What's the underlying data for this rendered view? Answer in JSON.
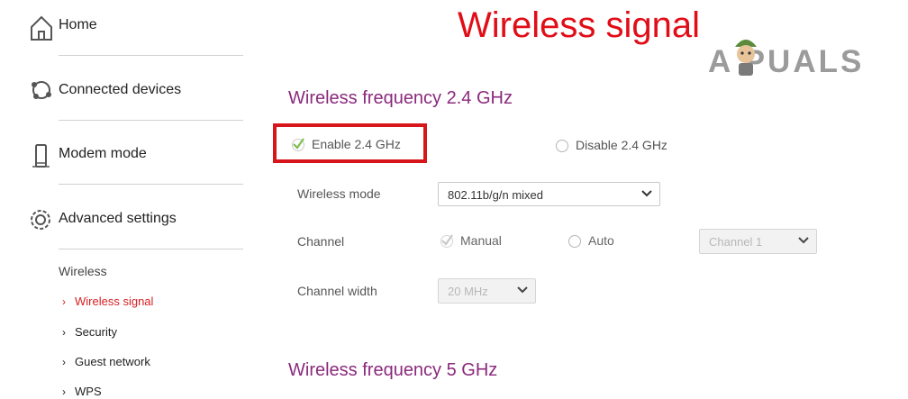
{
  "page": {
    "title": "Wireless signal"
  },
  "watermark": {
    "text": "A  PUALS"
  },
  "sidebar": {
    "items": [
      {
        "label": "Home",
        "icon": "home-icon"
      },
      {
        "label": "Connected devices",
        "icon": "devices-icon"
      },
      {
        "label": "Modem mode",
        "icon": "phone-icon"
      },
      {
        "label": "Advanced settings",
        "icon": "gear-icon"
      }
    ],
    "sub_heading": "Wireless",
    "sub_items": [
      {
        "label": "Wireless signal",
        "active": true
      },
      {
        "label": "Security"
      },
      {
        "label": "Guest network"
      },
      {
        "label": "WPS"
      }
    ]
  },
  "sections": {
    "band24": {
      "title": "Wireless frequency 2.4 GHz",
      "enable_label": "Enable 2.4 GHz",
      "disable_label": "Disable 2.4 GHz",
      "wireless_mode": {
        "label": "Wireless mode",
        "value": "802.11b/g/n mixed"
      },
      "channel": {
        "label": "Channel",
        "manual_label": "Manual",
        "auto_label": "Auto",
        "value": "Channel 1"
      },
      "channel_width": {
        "label": "Channel width",
        "value": "20 MHz"
      }
    },
    "band5": {
      "title": "Wireless frequency 5 GHz"
    }
  },
  "colors": {
    "title": "#e10d17",
    "section": "#8b2a7c",
    "highlight": "#d6161a",
    "active": "#d71e22",
    "check": "#7fbf4d"
  }
}
